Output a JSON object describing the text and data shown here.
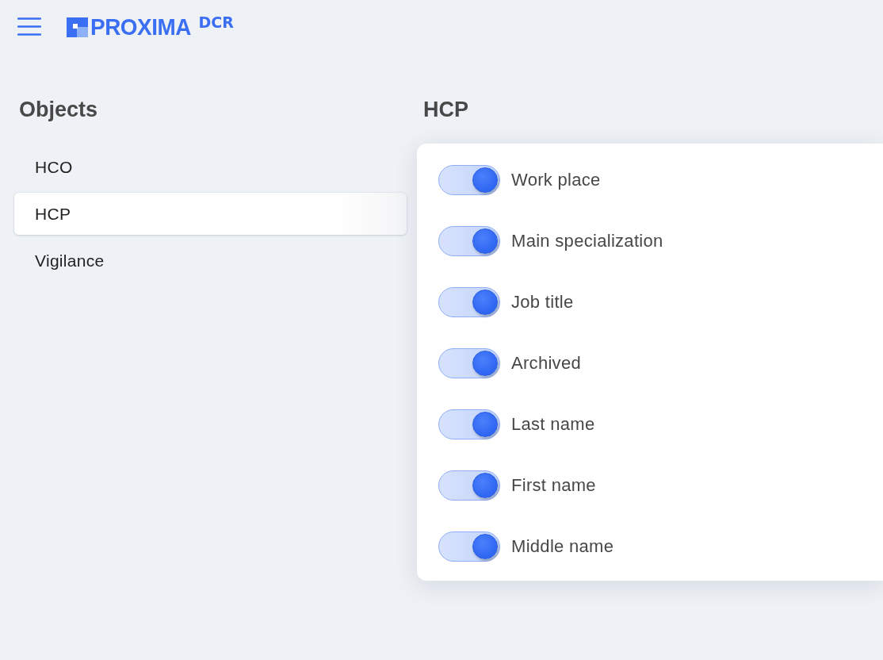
{
  "header": {
    "brand": "PROXIMA",
    "product": "DCR"
  },
  "sidebar": {
    "title": "Objects",
    "items": [
      {
        "label": "HCO",
        "selected": false
      },
      {
        "label": "HCP",
        "selected": true
      },
      {
        "label": "Vigilance",
        "selected": false
      }
    ]
  },
  "panel": {
    "title": "HCP",
    "fields": [
      {
        "label": "Work place",
        "on": true
      },
      {
        "label": "Main specialization",
        "on": true
      },
      {
        "label": "Job title",
        "on": true
      },
      {
        "label": "Archived",
        "on": true
      },
      {
        "label": "Last name",
        "on": true
      },
      {
        "label": "First name",
        "on": true
      },
      {
        "label": "Middle name",
        "on": true
      }
    ]
  }
}
